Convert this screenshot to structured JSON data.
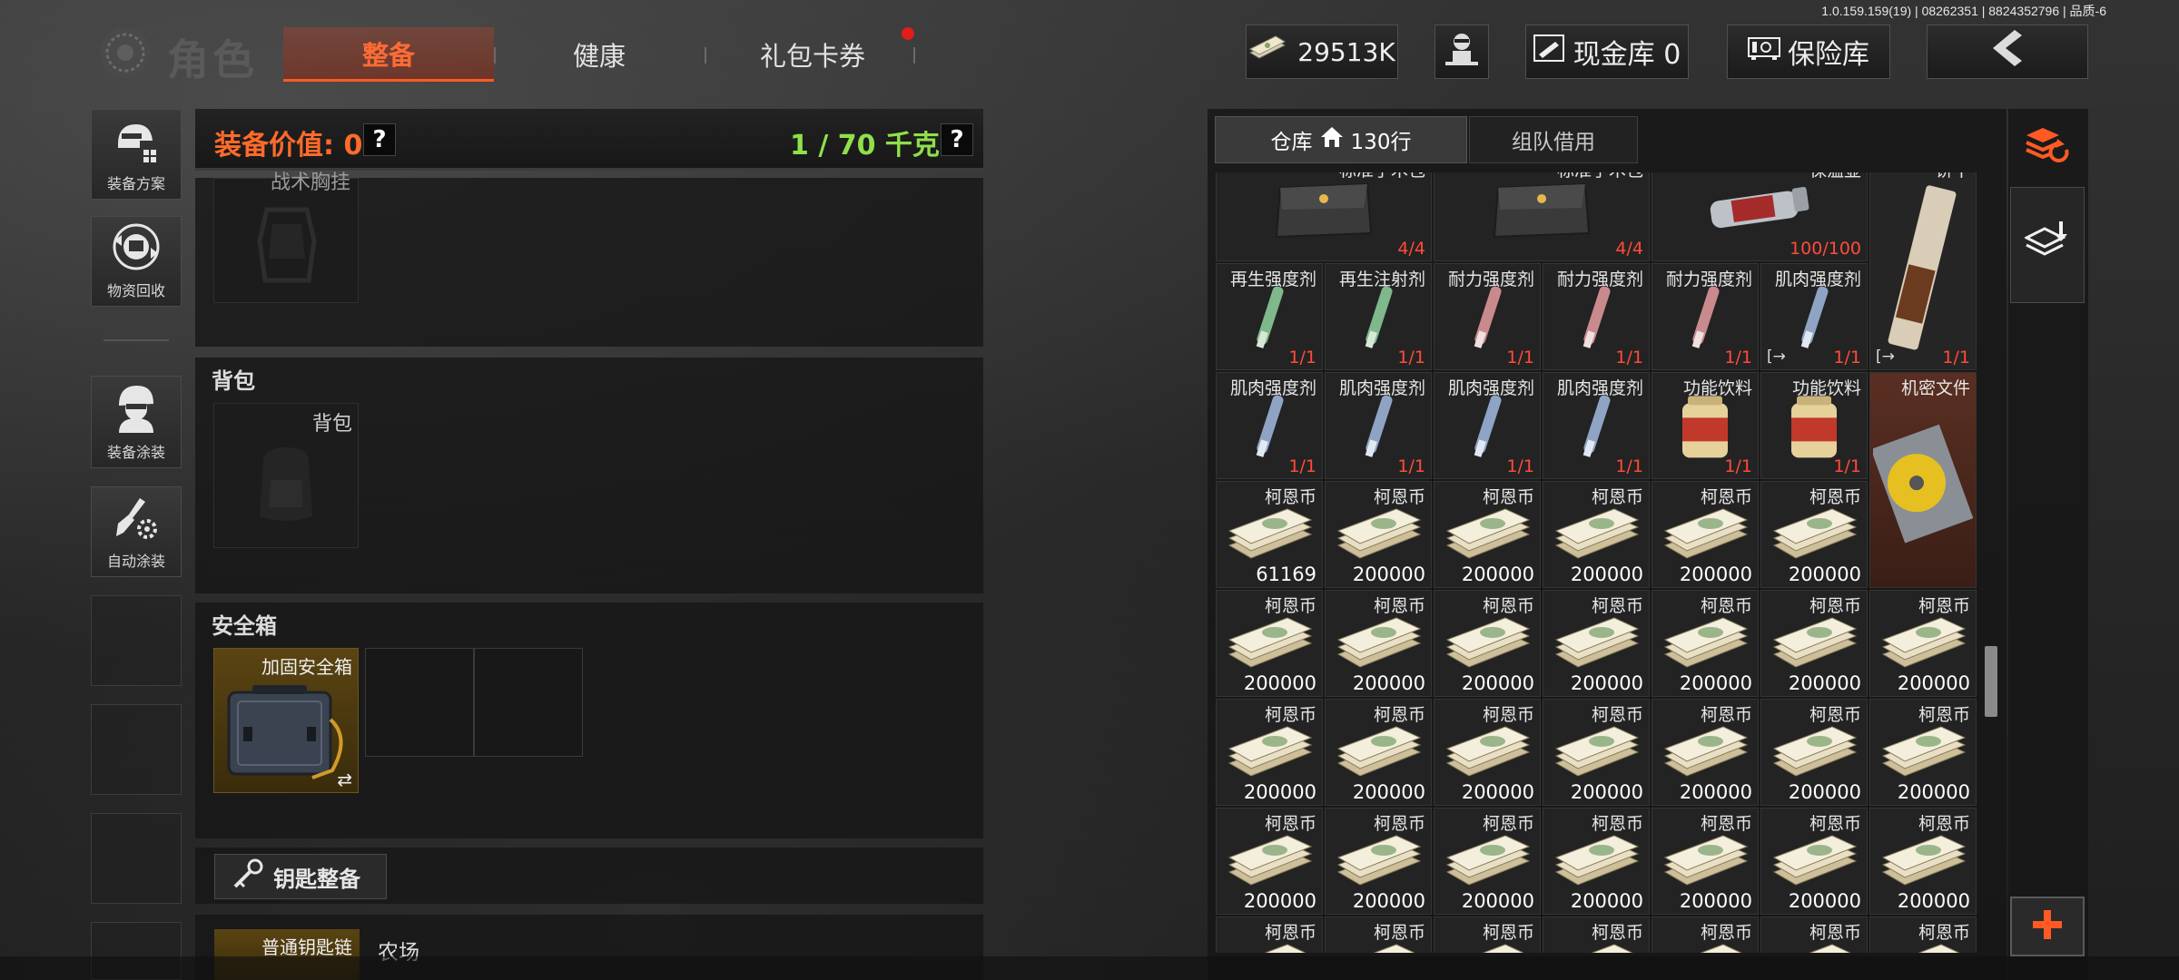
{
  "version": "1.0.159.159(19) | 08262351 | 8824352796 | 品质-6",
  "header": {
    "title": "角色",
    "tabs": [
      "整备",
      "健康",
      "礼包卡券"
    ],
    "cash": "29513K",
    "cash_vault_label": "现金库 0",
    "safe_vault_label": "保险库"
  },
  "sidebar": {
    "items": [
      "装备方案",
      "物资回收",
      "装备涂装",
      "自动涂装"
    ]
  },
  "equipment": {
    "value_label": "装备价值: 0",
    "weight_label": "1 / 70 千克",
    "help": "?",
    "top_slot_label": "战术胸挂",
    "backpack_section": "背包",
    "backpack_slot": "背包",
    "safe_section": "安全箱",
    "safe_item": "加固安全箱",
    "keys_button": "钥匙整备",
    "keychain_item": "普通钥匙链",
    "map_label": "农场"
  },
  "warehouse": {
    "tab_store": "仓库",
    "rows": "130行",
    "tab_team": "组队借用",
    "rows_data": [
      [
        {
          "name": "标准手术包",
          "count": "4/4",
          "kind": "medkit"
        },
        {
          "name": "标准手术包",
          "count": "4/4",
          "kind": "medkit"
        },
        {
          "name": "保温壶",
          "count": "100/100",
          "kind": "thermos"
        }
      ],
      [
        {
          "name": "再生强度剂",
          "count": "1/1",
          "kind": "inj-green"
        },
        {
          "name": "再生注射剂",
          "count": "1/1",
          "kind": "inj-green"
        },
        {
          "name": "耐力强度剂",
          "count": "1/1",
          "kind": "inj-pink"
        },
        {
          "name": "耐力强度剂",
          "count": "1/1",
          "kind": "inj-pink"
        },
        {
          "name": "耐力强度剂",
          "count": "1/1",
          "kind": "inj-pink"
        },
        {
          "name": "肌肉强度剂",
          "count": "1/1",
          "kind": "inj-blue",
          "mark": "[→"
        },
        {
          "name": "饼干",
          "count": "1/1",
          "kind": "biscuit",
          "mark": "[→"
        }
      ],
      [
        {
          "name": "肌肉强度剂",
          "count": "1/1",
          "kind": "inj-blue"
        },
        {
          "name": "肌肉强度剂",
          "count": "1/1",
          "kind": "inj-blue"
        },
        {
          "name": "肌肉强度剂",
          "count": "1/1",
          "kind": "inj-blue"
        },
        {
          "name": "肌肉强度剂",
          "count": "1/1",
          "kind": "inj-blue"
        },
        {
          "name": "功能饮料",
          "count": "1/1",
          "kind": "drink"
        },
        {
          "name": "功能饮料",
          "count": "1/1",
          "kind": "drink"
        },
        {
          "name": "机密文件",
          "count": "",
          "kind": "disc"
        }
      ],
      [
        {
          "name": "柯恩币",
          "count": "61169",
          "kind": "money"
        },
        {
          "name": "柯恩币",
          "count": "200000",
          "kind": "money"
        },
        {
          "name": "柯恩币",
          "count": "200000",
          "kind": "money"
        },
        {
          "name": "柯恩币",
          "count": "200000",
          "kind": "money"
        },
        {
          "name": "柯恩币",
          "count": "200000",
          "kind": "money"
        },
        {
          "name": "柯恩币",
          "count": "200000",
          "kind": "money"
        }
      ],
      [
        {
          "name": "柯恩币",
          "count": "200000",
          "kind": "money"
        },
        {
          "name": "柯恩币",
          "count": "200000",
          "kind": "money"
        },
        {
          "name": "柯恩币",
          "count": "200000",
          "kind": "money"
        },
        {
          "name": "柯恩币",
          "count": "200000",
          "kind": "money"
        },
        {
          "name": "柯恩币",
          "count": "200000",
          "kind": "money"
        },
        {
          "name": "柯恩币",
          "count": "200000",
          "kind": "money"
        },
        {
          "name": "柯恩币",
          "count": "200000",
          "kind": "money"
        }
      ],
      [
        {
          "name": "柯恩币",
          "count": "200000",
          "kind": "money"
        },
        {
          "name": "柯恩币",
          "count": "200000",
          "kind": "money"
        },
        {
          "name": "柯恩币",
          "count": "200000",
          "kind": "money"
        },
        {
          "name": "柯恩币",
          "count": "200000",
          "kind": "money"
        },
        {
          "name": "柯恩币",
          "count": "200000",
          "kind": "money"
        },
        {
          "name": "柯恩币",
          "count": "200000",
          "kind": "money"
        },
        {
          "name": "柯恩币",
          "count": "200000",
          "kind": "money"
        }
      ],
      [
        {
          "name": "柯恩币",
          "count": "200000",
          "kind": "money"
        },
        {
          "name": "柯恩币",
          "count": "200000",
          "kind": "money"
        },
        {
          "name": "柯恩币",
          "count": "200000",
          "kind": "money"
        },
        {
          "name": "柯恩币",
          "count": "200000",
          "kind": "money"
        },
        {
          "name": "柯恩币",
          "count": "200000",
          "kind": "money"
        },
        {
          "name": "柯恩币",
          "count": "200000",
          "kind": "money"
        },
        {
          "name": "柯恩币",
          "count": "200000",
          "kind": "money"
        }
      ],
      [
        {
          "name": "柯恩币",
          "count": "",
          "kind": "money"
        },
        {
          "name": "柯恩币",
          "count": "",
          "kind": "money"
        },
        {
          "name": "柯恩币",
          "count": "",
          "kind": "money"
        },
        {
          "name": "柯恩币",
          "count": "",
          "kind": "money"
        },
        {
          "name": "柯恩币",
          "count": "",
          "kind": "money"
        },
        {
          "name": "柯恩币",
          "count": "",
          "kind": "money"
        },
        {
          "name": "柯恩币",
          "count": "",
          "kind": "money"
        }
      ]
    ]
  },
  "colors": {
    "accent": "#ff6b35",
    "weight": "#8fe04a",
    "count_red": "#ff4b3a",
    "gold_slot": "#5a4412"
  }
}
